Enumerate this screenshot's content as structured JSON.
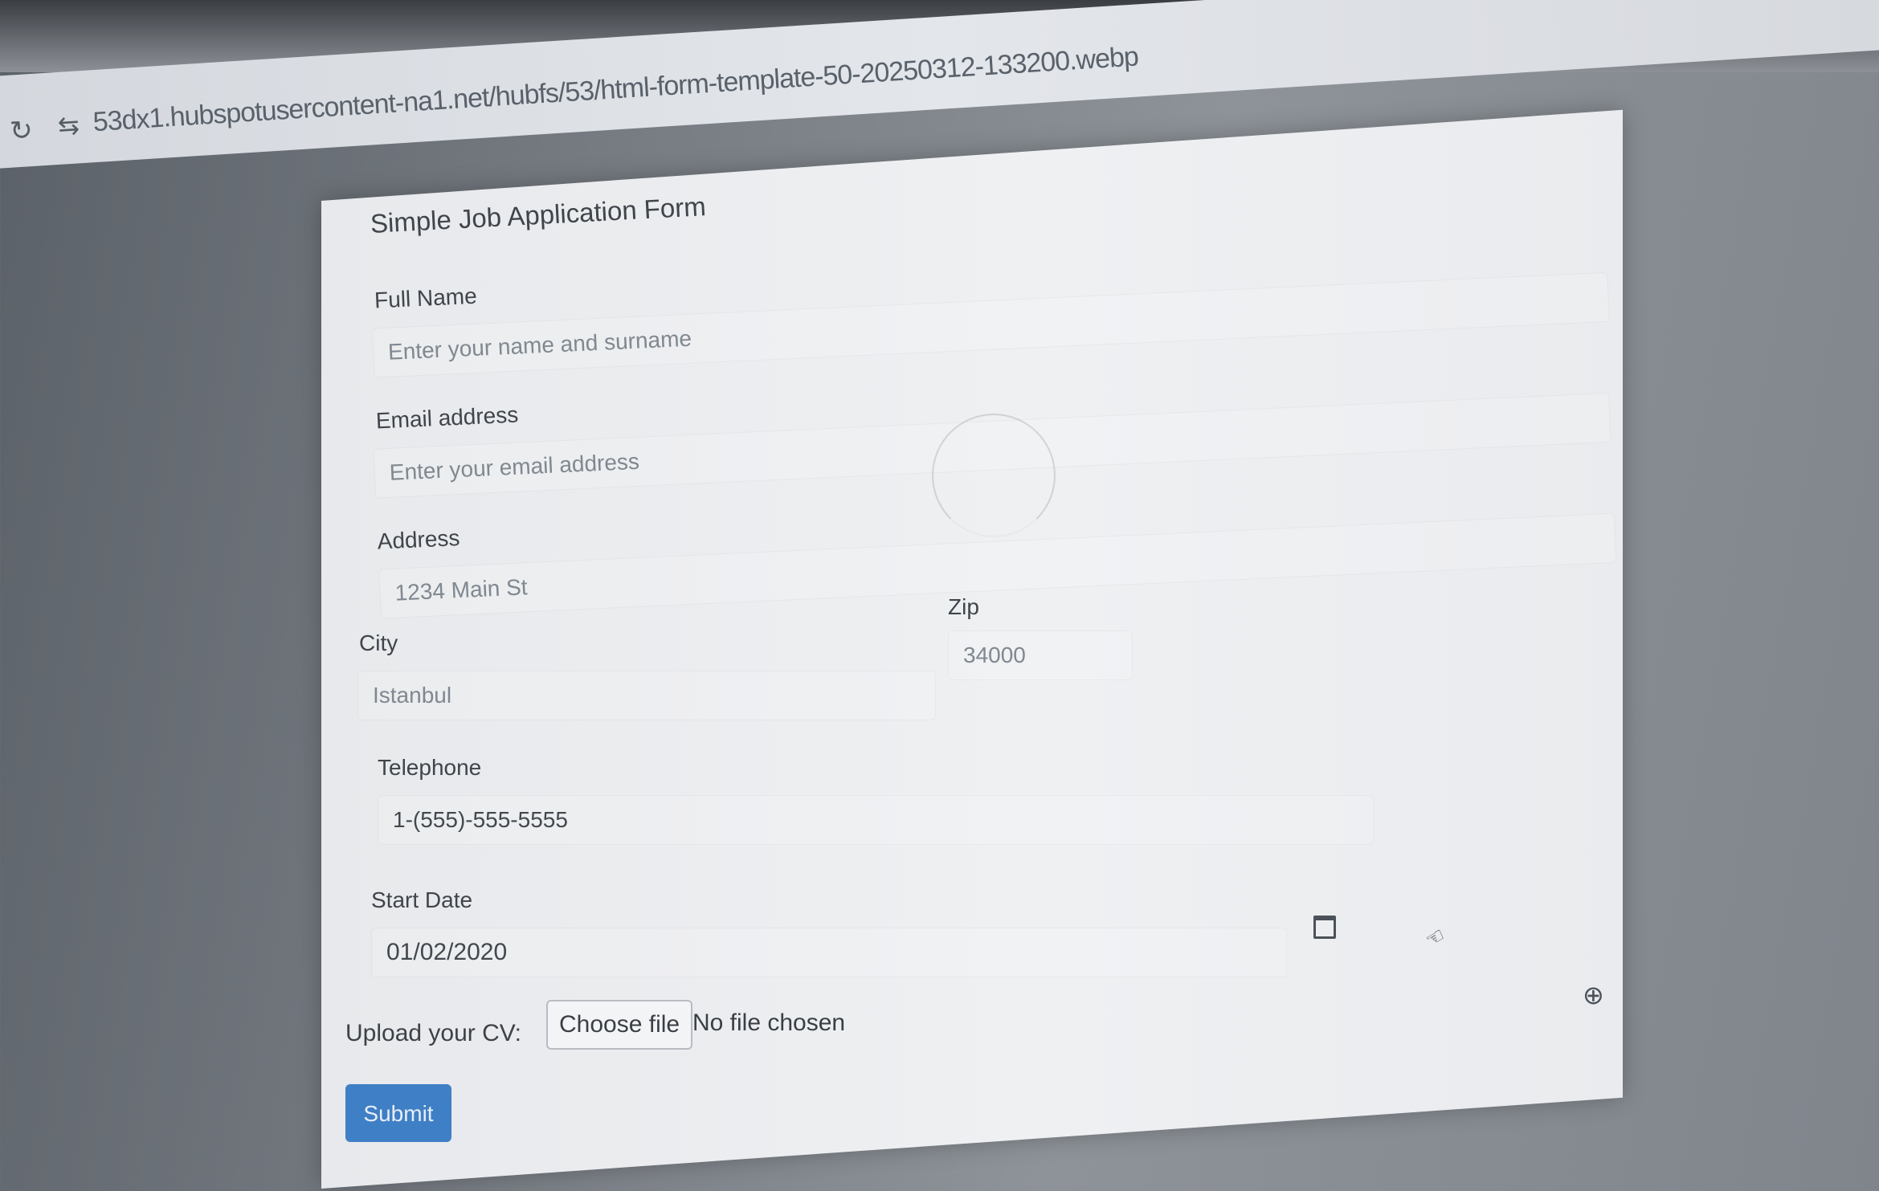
{
  "browser": {
    "url": "53dx1.hubspotusercontent-na1.net/hubfs/53/html-form-template-50-20250312-133200.webp"
  },
  "form": {
    "title": "Simple Job Application Form",
    "full_name": {
      "label": "Full Name",
      "placeholder": "Enter your name and surname"
    },
    "email": {
      "label": "Email address",
      "placeholder": "Enter your email address"
    },
    "address": {
      "label": "Address",
      "placeholder": "1234 Main St"
    },
    "city": {
      "label": "City",
      "placeholder": "Istanbul"
    },
    "zip": {
      "label": "Zip",
      "placeholder": "34000"
    },
    "telephone": {
      "label": "Telephone",
      "placeholder": "1-(555)-555-5555"
    },
    "start_date": {
      "label": "Start Date",
      "value": "01/02/2020"
    },
    "cv": {
      "label": "Upload your CV:",
      "button": "Choose file",
      "status": "No file chosen"
    },
    "submit_label": "Submit"
  },
  "icons": {
    "reload": "reload-icon",
    "tune": "tune-icon",
    "calendar": "calendar-icon",
    "cursor": "cursor-icon",
    "zoom": "zoom-in-icon"
  },
  "colors": {
    "submit": "#3f7fc6",
    "page": "#eceef1"
  }
}
